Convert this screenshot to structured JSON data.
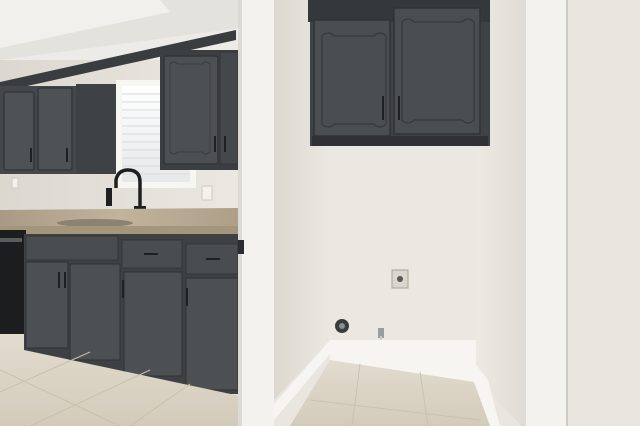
{
  "scene": {
    "description_hidden": "",
    "colors": {
      "wall": "#e8e4dc",
      "ceiling": "#efede8",
      "cabinet": "#4a4d50",
      "cabinet_dark": "#3b3e41",
      "trim": "#f4f3ef",
      "floor": "#d9d2c3",
      "counter": "#b9a88f",
      "steel": "#2c2d2f"
    }
  }
}
